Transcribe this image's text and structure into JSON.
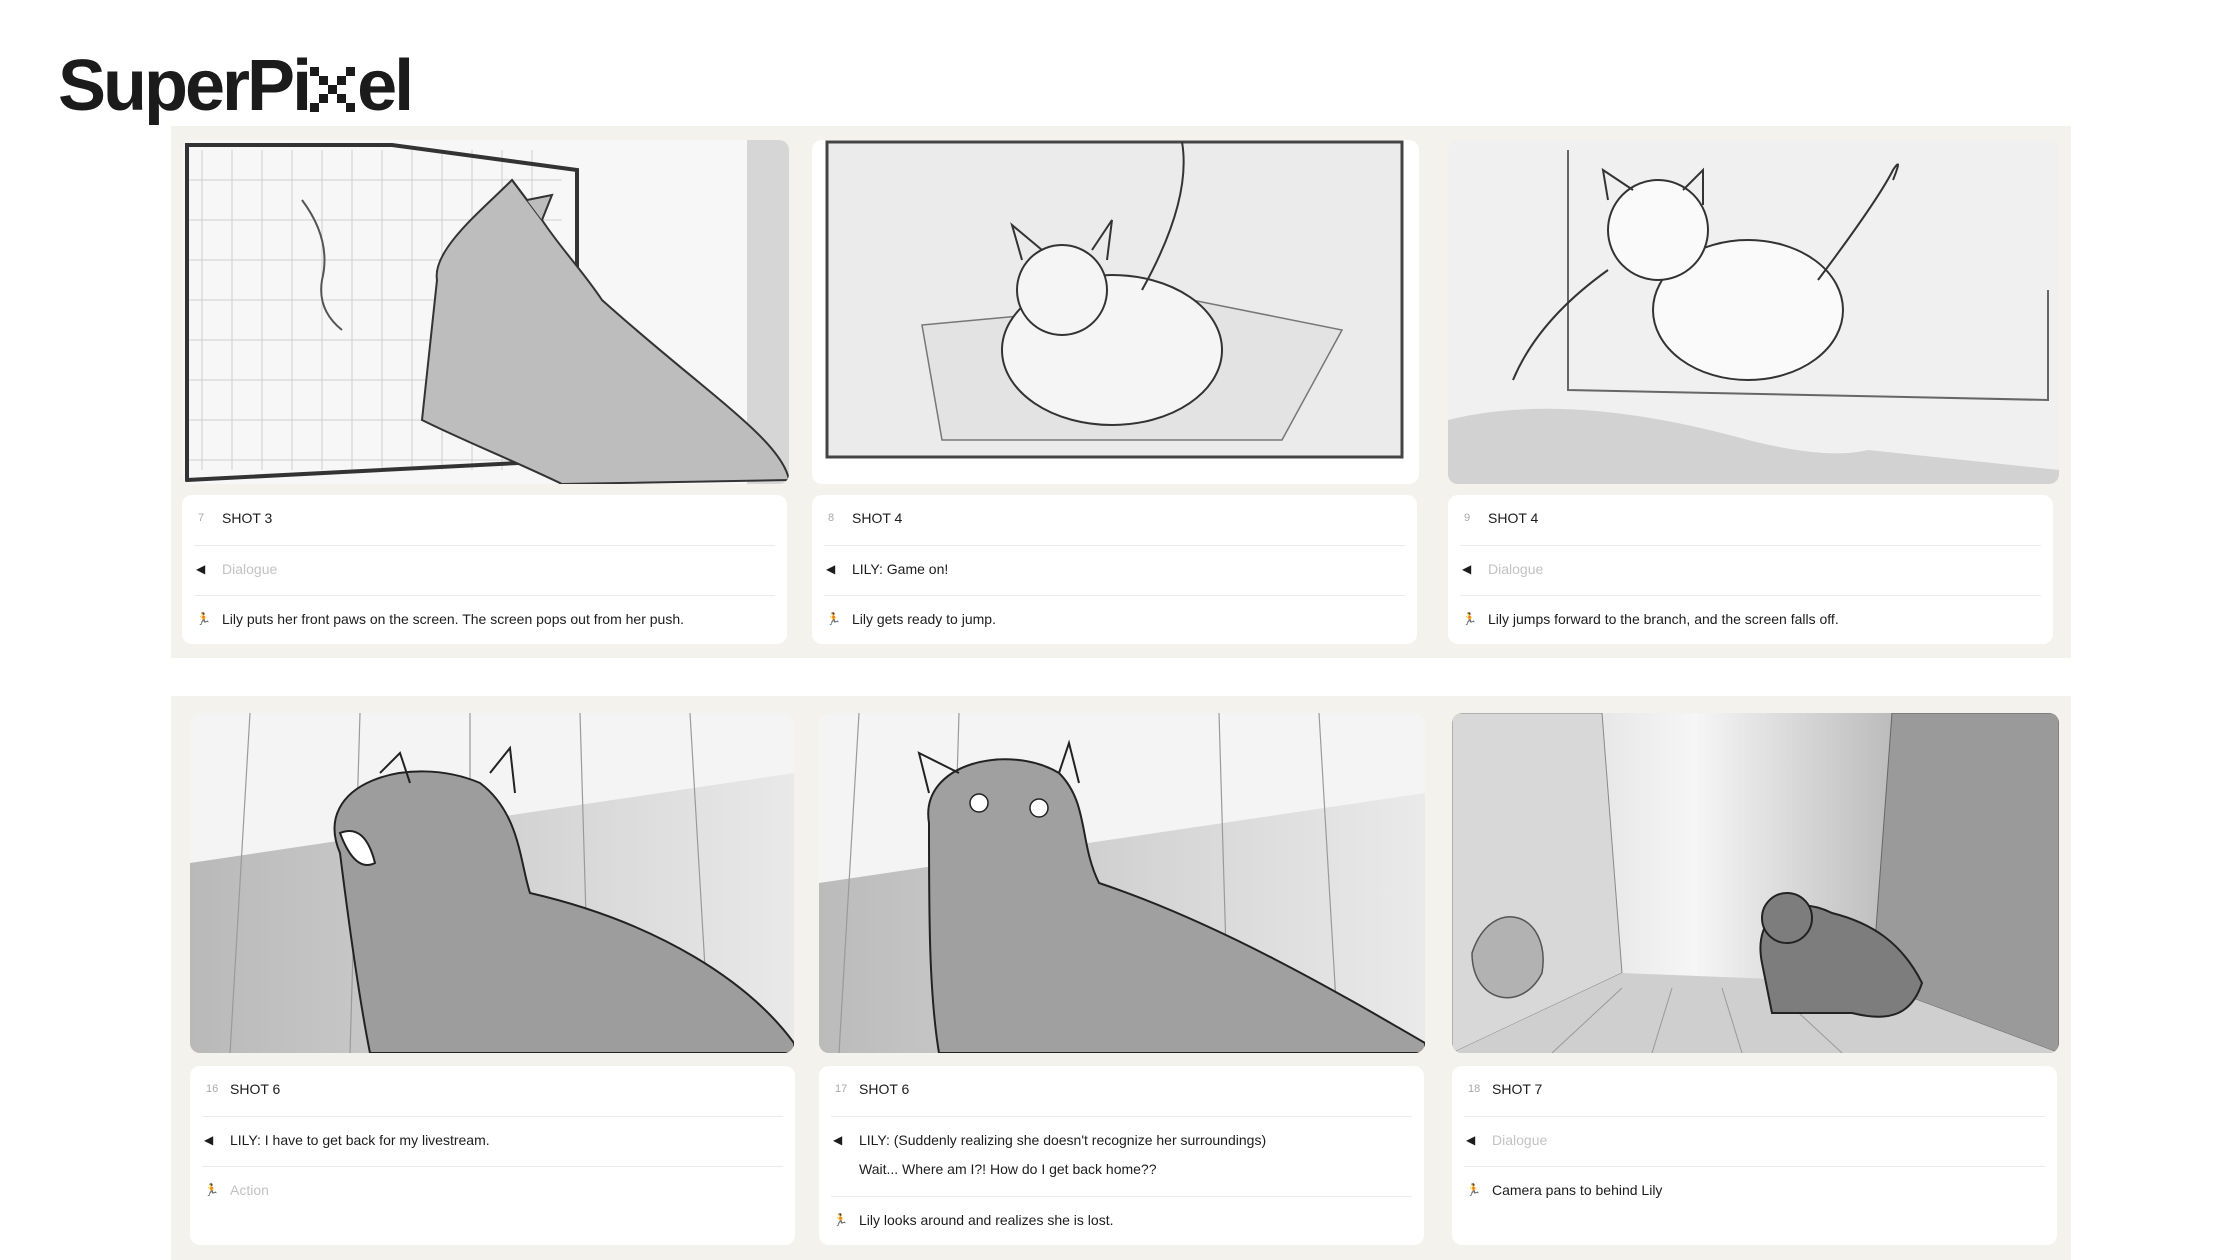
{
  "brand": {
    "logo_text_left": "SuperPi",
    "logo_text_right": "el"
  },
  "panels": [
    {
      "num": "7",
      "shot": "SHOT 3",
      "dialogue": "Dialogue",
      "dialogue_placeholder": true,
      "action": "Lily puts her front paws on the screen. The screen pops out from her push.",
      "action_placeholder": false
    },
    {
      "num": "8",
      "shot": "SHOT 4",
      "dialogue": "LILY: Game on!",
      "dialogue_placeholder": false,
      "action": "Lily gets ready to jump.",
      "action_placeholder": false
    },
    {
      "num": "9",
      "shot": "SHOT 4",
      "dialogue": "Dialogue",
      "dialogue_placeholder": true,
      "action": "Lily jumps forward to the branch, and the screen falls off.",
      "action_placeholder": false
    },
    {
      "num": "16",
      "shot": "SHOT 6",
      "dialogue": "LILY: I have to get back for my livestream.",
      "dialogue_placeholder": false,
      "action": "Action",
      "action_placeholder": true
    },
    {
      "num": "17",
      "shot": "SHOT 6",
      "dialogue": "LILY: (Suddenly realizing she doesn't recognize her surroundings)",
      "dialogue_2": "Wait... Where am I?! How do I get back home??",
      "dialogue_placeholder": false,
      "action": "Lily looks around and realizes she is lost.",
      "action_placeholder": false
    },
    {
      "num": "18",
      "shot": "SHOT 7",
      "dialogue": "Dialogue",
      "dialogue_placeholder": true,
      "action": "Camera pans to behind Lily",
      "action_placeholder": false
    }
  ],
  "icons": {
    "dialogue": "speaker-icon",
    "action": "running-figure-icon"
  },
  "colors": {
    "background": "#ffffff",
    "row_background": "#f3f2ec",
    "card": "#ffffff",
    "text": "#1c1c1c",
    "placeholder": "#c2c2c2",
    "frame_sketch": "#ececec"
  }
}
